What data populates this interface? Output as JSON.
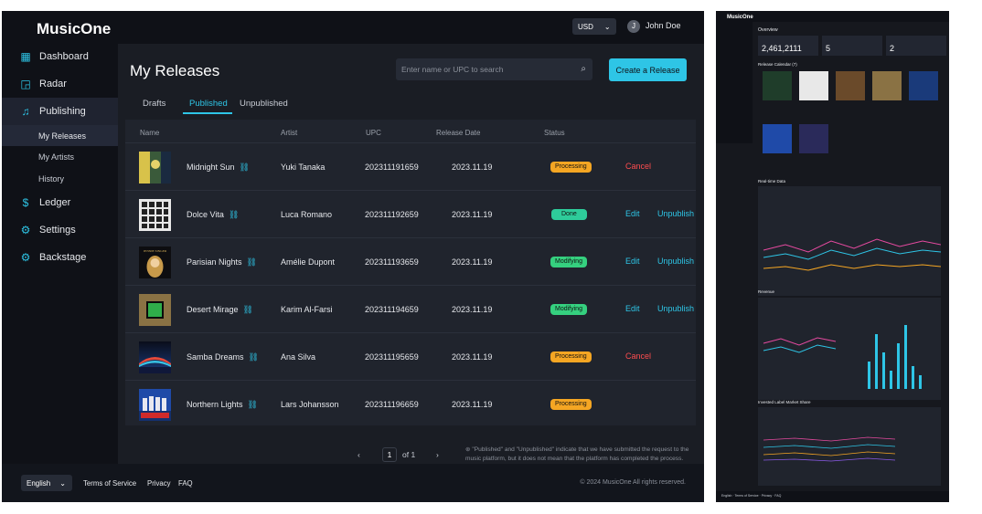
{
  "app": {
    "name": "MusicOne"
  },
  "colors": {
    "accent": "#2ec5e6",
    "processing": "#f5a623",
    "done": "#2ecc9a",
    "modifying": "#35d07f",
    "cancel": "#ff4d4f"
  },
  "header": {
    "currency": "USD",
    "avatar_initial": "J",
    "username": "John Doe"
  },
  "sidebar": {
    "items": [
      {
        "label": "Dashboard",
        "icon": "grid-icon"
      },
      {
        "label": "Radar",
        "icon": "chart-icon"
      },
      {
        "label": "Publishing",
        "icon": "music-note-icon"
      },
      {
        "label": "Ledger",
        "icon": "dollar-icon"
      },
      {
        "label": "Settings",
        "icon": "gear-icon"
      },
      {
        "label": "Backstage",
        "icon": "gear-icon"
      }
    ],
    "publishing_sub": [
      "My Releases",
      "My Artists",
      "History"
    ]
  },
  "page": {
    "title": "My Releases",
    "search_placeholder": "Enter name or UPC to search",
    "create_button": "Create a Release",
    "tabs": [
      "Drafts",
      "Published",
      "Unpublished"
    ]
  },
  "table": {
    "columns": [
      "Name",
      "Artist",
      "UPC",
      "Release Date",
      "Status"
    ],
    "rows": [
      {
        "name": "Midnight Sun",
        "artist": "Yuki Tanaka",
        "upc": "202311191659",
        "date": "2023.11.19",
        "status": "Processing",
        "actions": [
          "Cancel"
        ]
      },
      {
        "name": "Dolce Vita",
        "artist": "Luca Romano",
        "upc": "202311192659",
        "date": "2023.11.19",
        "status": "Done",
        "actions": [
          "Edit",
          "Unpublish"
        ]
      },
      {
        "name": "Parisian Nights",
        "artist": "Amélie Dupont",
        "upc": "202311193659",
        "date": "2023.11.19",
        "status": "Modifying",
        "actions": [
          "Edit",
          "Unpublish"
        ]
      },
      {
        "name": "Desert Mirage",
        "artist": "Karim Al-Farsi",
        "upc": "202311194659",
        "date": "2023.11.19",
        "status": "Modifying",
        "actions": [
          "Edit",
          "Unpublish"
        ]
      },
      {
        "name": "Samba Dreams",
        "artist": "Ana Silva",
        "upc": "202311195659",
        "date": "2023.11.19",
        "status": "Processing",
        "actions": [
          "Cancel"
        ]
      },
      {
        "name": "Northern Lights",
        "artist": "Lars Johansson",
        "upc": "202311196659",
        "date": "2023.11.19",
        "status": "Processing",
        "actions": []
      }
    ]
  },
  "pagination": {
    "current": "1",
    "of_text": "of 1"
  },
  "note": "\"Published\" and \"Unpublished\" indicate that we have submitted the request to the music platform, but it does not mean that the platform has completed the process.",
  "footer": {
    "language": "English",
    "links": [
      "Terms of Service",
      "Privacy",
      "FAQ"
    ],
    "copyright": "© 2024 MusicOne All rights reserved."
  },
  "thumbnail": {
    "logo": "MusicOne",
    "overview_title": "Overview",
    "stats": [
      "2,461,2111",
      "5",
      "2"
    ],
    "release_calendar_title": "Release Calendar (7)",
    "realtime_title": "Real-time Data",
    "revenue_title": "Revenue",
    "market_share_title": "Invested Label Market Share",
    "footer_text": "English · Terms of Service · Privacy · FAQ"
  }
}
